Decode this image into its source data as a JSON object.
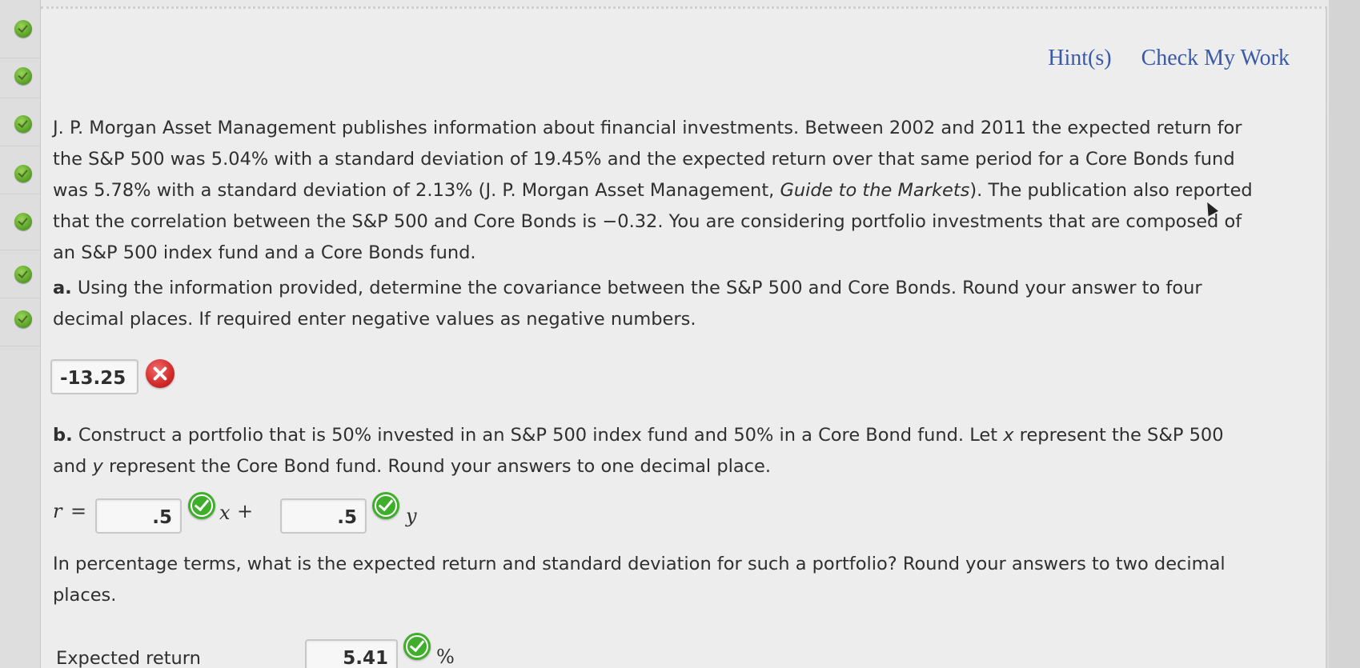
{
  "header": {
    "hints_link": "Hint(s)",
    "check_work_link": "Check My Work"
  },
  "problem": {
    "intro_line1": "J. P. Morgan Asset Management publishes information about financial investments. Between 2002 and 2011 the expected return for",
    "intro_line2": "the S&P 500 was 5.04% with a standard deviation of 19.45% and the expected return over that same period for a Core Bonds fund",
    "intro_line3a": "was 5.78% with a standard deviation of 2.13% (J. P. Morgan Asset Management, ",
    "intro_line3_italic": "Guide to the Markets",
    "intro_line3b": "). The publication also reported",
    "intro_line4": "that the correlation between the S&P 500 and Core Bonds is −0.32. You are considering portfolio investments that are composed of",
    "intro_line5": "an S&P 500 index fund and a Core Bonds fund."
  },
  "part_a": {
    "label": "a.",
    "line1": "Using the information provided, determine the covariance between the S&P 500 and Core Bonds. Round your answer to four",
    "line2": "decimal places. If required enter negative values as negative numbers.",
    "answer_value": "-13.25",
    "status_icon": "incorrect-x-icon"
  },
  "part_b": {
    "label": "b.",
    "line1a": "Construct a portfolio that is 50% invested in an S&P 500 index fund and 50% in a Core Bond fund. Let ",
    "line1_var_x": "x",
    "line1b": " represent the S&P 500",
    "line2a": "and ",
    "line2_var_y": "y",
    "line2b": " represent the Core Bond fund. Round your answers to one decimal place.",
    "eq_r": "r",
    "eq_equals": "=",
    "x_coef_value": ".5",
    "eq_x": "x",
    "eq_plus": "+",
    "y_coef_value": ".5",
    "eq_y": "y",
    "question_line1": "In percentage terms, what is the expected return and standard deviation for such a portfolio? Round your answers to two decimal",
    "question_line2": "places.",
    "expected_return_label": "Expected return",
    "expected_return_value": "5.41",
    "expected_return_unit": "%"
  },
  "colors": {
    "link": "#3a5aa8",
    "correct": "#3fae2a",
    "incorrect": "#d12a2a",
    "sidebar_status": "#5da62a"
  },
  "sidebar": {
    "status_icons": [
      "check-circle-icon",
      "check-circle-icon",
      "check-circle-icon",
      "check-circle-icon",
      "check-circle-icon",
      "check-circle-icon",
      "check-circle-icon"
    ]
  }
}
